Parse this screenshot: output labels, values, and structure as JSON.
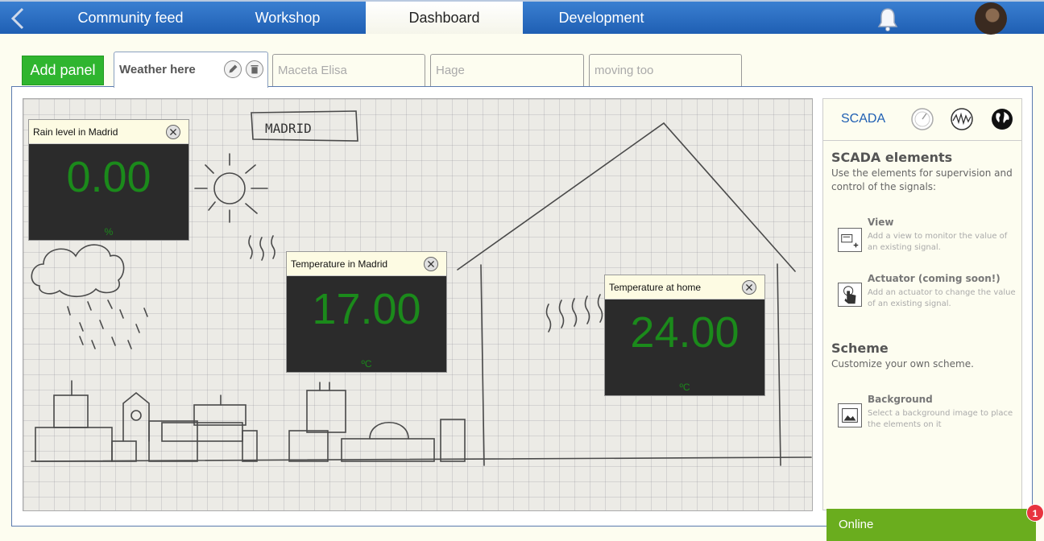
{
  "nav": {
    "tabs": [
      {
        "label": "Community feed"
      },
      {
        "label": "Workshop"
      },
      {
        "label": "Dashboard"
      },
      {
        "label": "Development"
      }
    ],
    "active_tab": "Dashboard"
  },
  "panels": {
    "add_label": "Add panel",
    "tabs": [
      {
        "label": "Weather here"
      },
      {
        "label": "Maceta Elisa"
      },
      {
        "label": "Hage"
      },
      {
        "label": "moving too"
      }
    ]
  },
  "canvas": {
    "sketch_text": "MADRID"
  },
  "widgets": [
    {
      "title": "Rain level in Madrid",
      "value": "0.00",
      "unit": "%"
    },
    {
      "title": "Temperature in Madrid",
      "value": "17.00",
      "unit": "ºC"
    },
    {
      "title": "Temperature at home",
      "value": "24.00",
      "unit": "ºC"
    }
  ],
  "side": {
    "tab_label": "SCADA",
    "elements_title": "SCADA elements",
    "elements_desc": "Use the elements for supervision and control of the signals:",
    "items": [
      {
        "title": "View",
        "desc": "Add a view to monitor the value of an existing signal."
      },
      {
        "title": "Actuator (coming soon!)",
        "desc": "Add an actuator to change the value of an existing signal."
      }
    ],
    "scheme_title": "Scheme",
    "scheme_desc": "Customize your own scheme.",
    "scheme_items": [
      {
        "title": "Background",
        "desc": "Select a background image to place the elements on it"
      }
    ]
  },
  "status": {
    "online_label": "Online",
    "badge_count": "1"
  },
  "colors": {
    "nav_blue": "#1f5fb3",
    "add_green": "#2fb52f",
    "value_green": "#1b8a1b",
    "online_green": "#6aad1e",
    "badge_red": "#e8343f"
  }
}
